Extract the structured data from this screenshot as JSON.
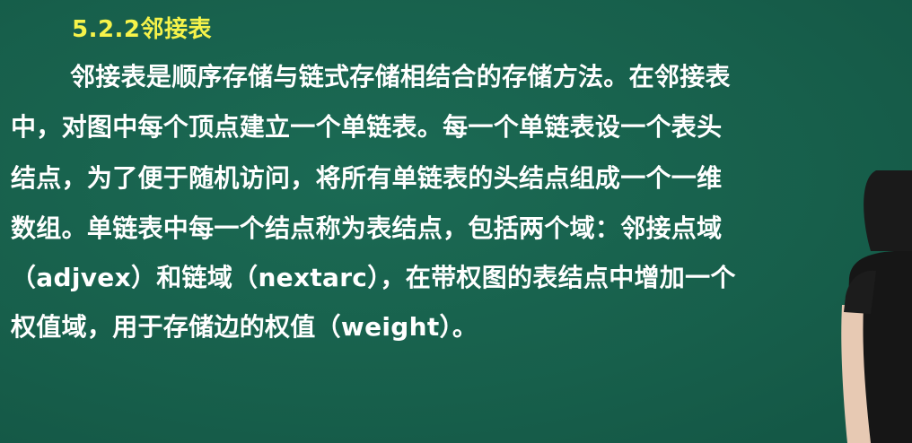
{
  "slide": {
    "title": "5.2.2邻接表",
    "lines": [
      "邻接表是顺序存储与链式存储相结合的存储方法。在邻接表",
      "中，对图中每个顶点建立一个单链表。每一个单链表设一个表头",
      "结点，为了便于随机访问，将所有单链表的头结点组成一个一维",
      "数组。单链表中每一个结点称为表结点，包括两个域：邻接点域",
      "（adjvex）和链域（nextarc），在带权图的表结点中增加一个",
      "权值域，用于存储边的权值（weight）。"
    ]
  },
  "colors": {
    "board": "#17604c",
    "title": "#f6f34a",
    "text": "#ffffff"
  }
}
